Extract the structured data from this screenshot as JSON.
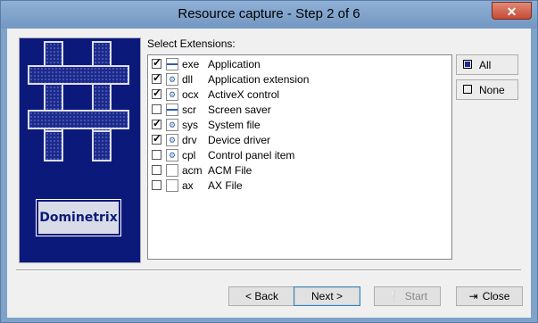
{
  "window": {
    "title": "Resource capture - Step 2 of 6",
    "close_label": "✕"
  },
  "banner": {
    "logo_text": "Dominetrix"
  },
  "extensions": {
    "label": "Select Extensions:",
    "items": [
      {
        "ext": "exe",
        "desc": "Application",
        "checked": true,
        "icon": "app"
      },
      {
        "ext": "dll",
        "desc": "Application extension",
        "checked": true,
        "icon": "gear"
      },
      {
        "ext": "ocx",
        "desc": "ActiveX control",
        "checked": true,
        "icon": "gear"
      },
      {
        "ext": "scr",
        "desc": "Screen saver",
        "checked": false,
        "icon": "app"
      },
      {
        "ext": "sys",
        "desc": "System file",
        "checked": true,
        "icon": "gear"
      },
      {
        "ext": "drv",
        "desc": "Device driver",
        "checked": true,
        "icon": "gear"
      },
      {
        "ext": "cpl",
        "desc": "Control panel item",
        "checked": false,
        "icon": "gear"
      },
      {
        "ext": "acm",
        "desc": "ACM File",
        "checked": false,
        "icon": "blank"
      },
      {
        "ext": "ax",
        "desc": "AX File",
        "checked": false,
        "icon": "blank"
      }
    ]
  },
  "side_buttons": {
    "all": "All",
    "none": "None"
  },
  "nav": {
    "back": "< Back",
    "next": "Next >",
    "start": "Start",
    "close": "Close"
  }
}
